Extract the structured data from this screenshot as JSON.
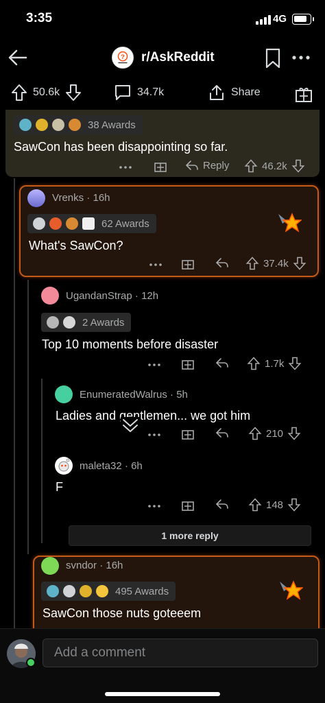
{
  "status": {
    "time": "3:35",
    "network": "4G",
    "battery_level": 0.85
  },
  "header": {
    "subreddit": "r/AskReddit"
  },
  "post_actions": {
    "upvotes": "50.6k",
    "comments": "34.7k",
    "share": "Share"
  },
  "comments": {
    "c1": {
      "awards": "38 Awards",
      "body": "SawCon has been disappointing so far.",
      "reply": "Reply",
      "score": "46.2k"
    },
    "c2": {
      "user": "Vrenks",
      "age": "16h",
      "awards": "62 Awards",
      "body": "What's SawCon?",
      "score": "37.4k"
    },
    "c3": {
      "user": "UgandanStrap",
      "age": "12h",
      "awards": "2 Awards",
      "body": "Top 10 moments before disaster",
      "score": "1.7k"
    },
    "c4": {
      "user": "EnumeratedWalrus",
      "age": "5h",
      "body": "Ladies and gentlemen... we got him",
      "score": "210"
    },
    "c5": {
      "user": "maleta32",
      "age": "6h",
      "body": "F",
      "score": "148"
    },
    "more": "1 more reply",
    "c6": {
      "user": "svndor",
      "age": "16h",
      "awards": "495 Awards",
      "body": "SawCon those nuts goteeem"
    }
  },
  "composer": {
    "placeholder": "Add a comment"
  },
  "colors": {
    "accent_border": "#c45a18",
    "online": "#46d160"
  }
}
